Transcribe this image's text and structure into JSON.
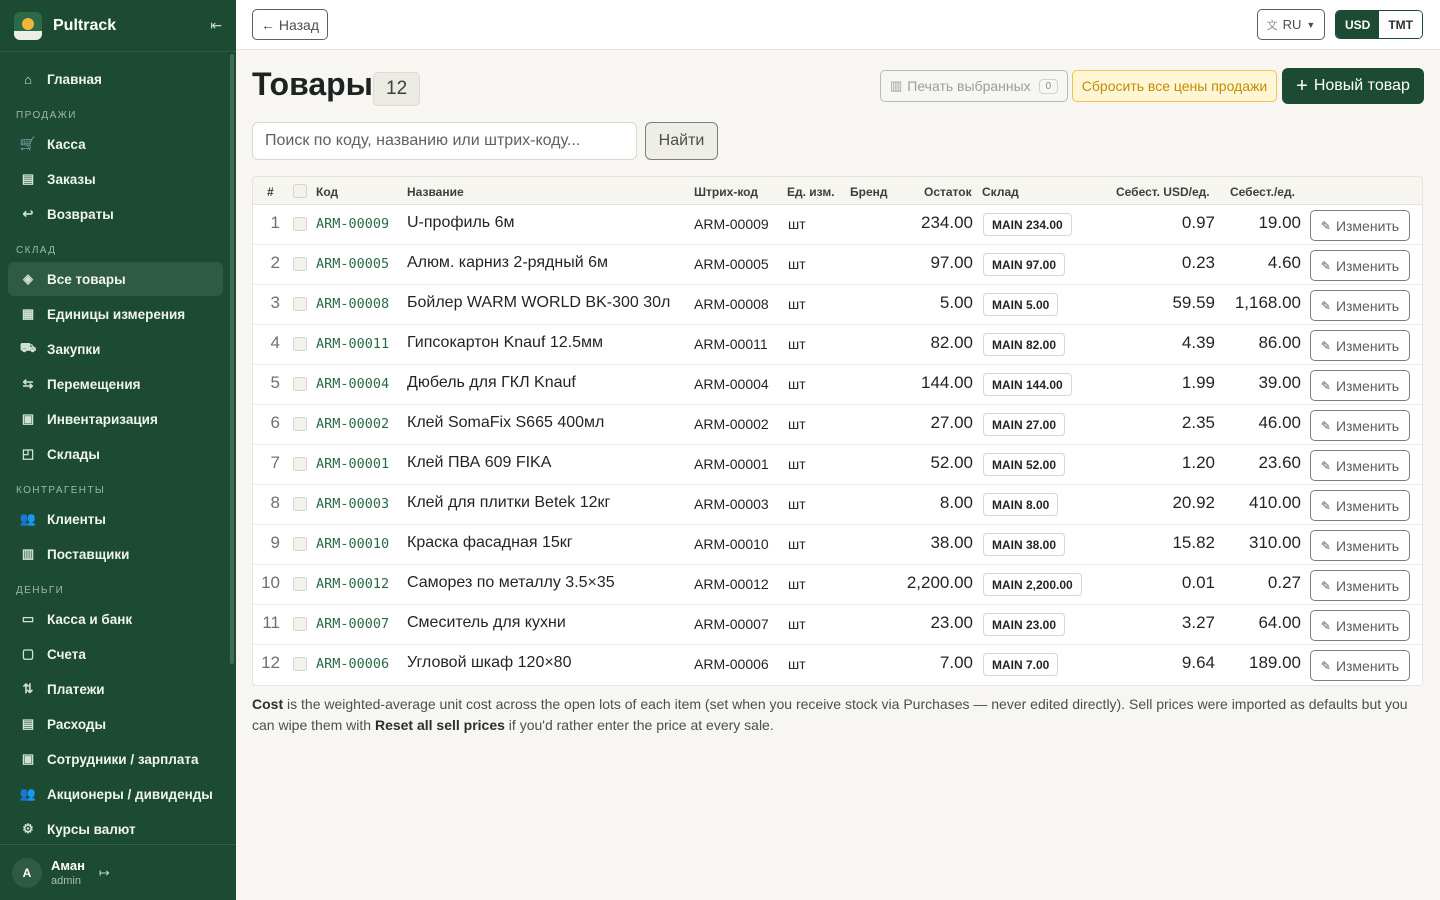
{
  "app": {
    "brand": "Pultrack"
  },
  "sidebar": {
    "items_top": [
      {
        "label": "Главная",
        "icon": "home-icon",
        "glyph": "⌂"
      }
    ],
    "sections": [
      {
        "title": "ПРОДАЖИ",
        "items": [
          {
            "label": "Касса",
            "icon": "cart-icon",
            "glyph": "🛒"
          },
          {
            "label": "Заказы",
            "icon": "clipboard-icon",
            "glyph": "▤"
          },
          {
            "label": "Возвраты",
            "icon": "return-icon",
            "glyph": "↩"
          }
        ]
      },
      {
        "title": "СКЛАД",
        "items": [
          {
            "label": "Все товары",
            "icon": "box-icon",
            "glyph": "◈",
            "active": true
          },
          {
            "label": "Единицы измерения",
            "icon": "ruler-icon",
            "glyph": "▦"
          },
          {
            "label": "Закупки",
            "icon": "truck-icon",
            "glyph": "⛟"
          },
          {
            "label": "Перемещения",
            "icon": "transfer-icon",
            "glyph": "⇆"
          },
          {
            "label": "Инвентаризация",
            "icon": "checklist-icon",
            "glyph": "▣"
          },
          {
            "label": "Склады",
            "icon": "warehouse-icon",
            "glyph": "◰"
          }
        ]
      },
      {
        "title": "КОНТРАГЕНТЫ",
        "items": [
          {
            "label": "Клиенты",
            "icon": "users-icon",
            "glyph": "👥"
          },
          {
            "label": "Поставщики",
            "icon": "building-icon",
            "glyph": "▥"
          }
        ]
      },
      {
        "title": "ДЕНЬГИ",
        "items": [
          {
            "label": "Касса и банк",
            "icon": "wallet-icon",
            "glyph": "▭"
          },
          {
            "label": "Счета",
            "icon": "folder-icon",
            "glyph": "▢"
          },
          {
            "label": "Платежи",
            "icon": "arrows-updown-icon",
            "glyph": "⇅"
          },
          {
            "label": "Расходы",
            "icon": "receipt-icon",
            "glyph": "▤"
          },
          {
            "label": "Сотрудники / зарплата",
            "icon": "badge-icon",
            "glyph": "▣"
          },
          {
            "label": "Акционеры / дивиденды",
            "icon": "people-icon",
            "glyph": "👥"
          },
          {
            "label": "Курсы валют",
            "icon": "currency-icon",
            "glyph": "⚙"
          }
        ]
      }
    ],
    "user": {
      "initial": "A",
      "name": "Аман",
      "role": "admin"
    }
  },
  "topbar": {
    "back_label": "← Назад",
    "lang": "RU",
    "currencies": [
      "USD",
      "TMT"
    ],
    "active_currency": "USD"
  },
  "page": {
    "title": "Товары",
    "count": "12",
    "print_label": "Печать выбранных",
    "print_count": "0",
    "reset_label": "Сбросить все цены продажи",
    "new_label": "Новый товар",
    "search_placeholder": "Поиск по коду, названию или штрих-коду...",
    "find_label": "Найти"
  },
  "table": {
    "headers": {
      "num": "#",
      "code": "Код",
      "name": "Название",
      "barcode": "Штрих-код",
      "unit": "Ед. изм.",
      "brand": "Бренд",
      "stock": "Остаток",
      "warehouse": "Склад",
      "cost_usd": "Себест. USD/ед.",
      "cost": "Себест./ед."
    },
    "edit_label": "Изменить",
    "rows": [
      {
        "num": "1",
        "code": "ARM-00009",
        "name": "U-профиль 6м",
        "barcode": "ARM-00009",
        "unit": "шт",
        "stock": "234.00",
        "warehouse": "MAIN 234.00",
        "cost_usd": "0.97",
        "cost": "19.00"
      },
      {
        "num": "2",
        "code": "ARM-00005",
        "name": "Алюм. карниз 2-рядный 6м",
        "barcode": "ARM-00005",
        "unit": "шт",
        "stock": "97.00",
        "warehouse": "MAIN 97.00",
        "cost_usd": "0.23",
        "cost": "4.60"
      },
      {
        "num": "3",
        "code": "ARM-00008",
        "name": "Бойлер WARM WORLD BK-300 30л",
        "barcode": "ARM-00008",
        "unit": "шт",
        "stock": "5.00",
        "warehouse": "MAIN 5.00",
        "cost_usd": "59.59",
        "cost": "1,168.00"
      },
      {
        "num": "4",
        "code": "ARM-00011",
        "name": "Гипсокартон Knauf 12.5мм",
        "barcode": "ARM-00011",
        "unit": "шт",
        "stock": "82.00",
        "warehouse": "MAIN 82.00",
        "cost_usd": "4.39",
        "cost": "86.00"
      },
      {
        "num": "5",
        "code": "ARM-00004",
        "name": "Дюбель для ГКЛ Knauf",
        "barcode": "ARM-00004",
        "unit": "шт",
        "stock": "144.00",
        "warehouse": "MAIN 144.00",
        "cost_usd": "1.99",
        "cost": "39.00"
      },
      {
        "num": "6",
        "code": "ARM-00002",
        "name": "Клей SomaFix S665 400мл",
        "barcode": "ARM-00002",
        "unit": "шт",
        "stock": "27.00",
        "warehouse": "MAIN 27.00",
        "cost_usd": "2.35",
        "cost": "46.00"
      },
      {
        "num": "7",
        "code": "ARM-00001",
        "name": "Клей ПВА 609 FIKA",
        "barcode": "ARM-00001",
        "unit": "шт",
        "stock": "52.00",
        "warehouse": "MAIN 52.00",
        "cost_usd": "1.20",
        "cost": "23.60"
      },
      {
        "num": "8",
        "code": "ARM-00003",
        "name": "Клей для плитки Betek 12кг",
        "barcode": "ARM-00003",
        "unit": "шт",
        "stock": "8.00",
        "warehouse": "MAIN 8.00",
        "cost_usd": "20.92",
        "cost": "410.00"
      },
      {
        "num": "9",
        "code": "ARM-00010",
        "name": "Краска фасадная 15кг",
        "barcode": "ARM-00010",
        "unit": "шт",
        "stock": "38.00",
        "warehouse": "MAIN 38.00",
        "cost_usd": "15.82",
        "cost": "310.00"
      },
      {
        "num": "10",
        "code": "ARM-00012",
        "name": "Саморез по металлу 3.5×35",
        "barcode": "ARM-00012",
        "unit": "шт",
        "stock": "2,200.00",
        "warehouse": "MAIN 2,200.00",
        "cost_usd": "0.01",
        "cost": "0.27"
      },
      {
        "num": "11",
        "code": "ARM-00007",
        "name": "Смеситель для кухни",
        "barcode": "ARM-00007",
        "unit": "шт",
        "stock": "23.00",
        "warehouse": "MAIN 23.00",
        "cost_usd": "3.27",
        "cost": "64.00"
      },
      {
        "num": "12",
        "code": "ARM-00006",
        "name": "Угловой шкаф 120×80",
        "barcode": "ARM-00006",
        "unit": "шт",
        "stock": "7.00",
        "warehouse": "MAIN 7.00",
        "cost_usd": "9.64",
        "cost": "189.00"
      }
    ]
  },
  "note": {
    "bold1": "Cost",
    "text1": " is the weighted-average unit cost across the open lots of each item (set when you receive stock via Purchases — never edited directly). Sell prices were imported as defaults but you can wipe them with ",
    "bold2": "Reset all sell prices",
    "text2": " if you'd rather enter the price at every sale."
  },
  "colors": {
    "sidebar_bg": "#1d4a32",
    "accent": "#1d4a32",
    "code_link": "#2a6a43",
    "reset_border": "#f0c44a"
  }
}
